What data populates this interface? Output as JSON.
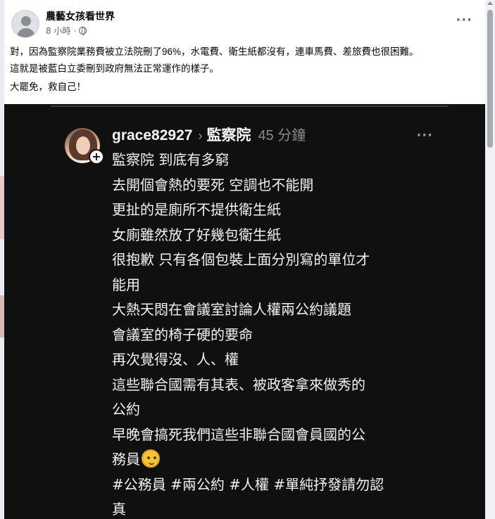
{
  "post": {
    "page_name": "農藝女孩看世界",
    "timestamp": "8 小時",
    "dot": "·",
    "privacy_icon": "globe-icon",
    "more_icon": "ellipsis-icon",
    "more_label": "···",
    "text_lines": [
      "對，因為監察院業務費被立法院刪了96%，水電費、衛生紙都沒有，連車馬費、差旅費也很困難。",
      "這就是被藍白立委刪到政府無法正常運作的樣子。",
      "大罷免，救自己！"
    ]
  },
  "screenshot": {
    "username": "grace82927",
    "chevron": "›",
    "topic": "監察院",
    "time": "45 分鐘",
    "more_label": "···",
    "plus_label": "+",
    "lines": [
      "監察院 到底有多窮",
      "去開個會熱的要死 空調也不能開",
      "更扯的是廁所不提供衛生紙",
      "女廁雖然放了好幾包衛生紙",
      "很抱歉 只有各個包裝上面分別寫的單位才",
      "能用",
      "大熱天悶在會議室討論人權兩公約議題",
      "會議室的椅子硬的要命",
      "再次覺得沒、人、權",
      "這些聯合國需有其表、被政客拿來做秀的",
      "公約",
      "早晚會搞死我們這些非聯合國會員國的公",
      "務員",
      "#公務員 #兩公約 #人權 #單純抒發請勿認",
      "真"
    ],
    "emoji_icon": "face-emoji-icon"
  }
}
